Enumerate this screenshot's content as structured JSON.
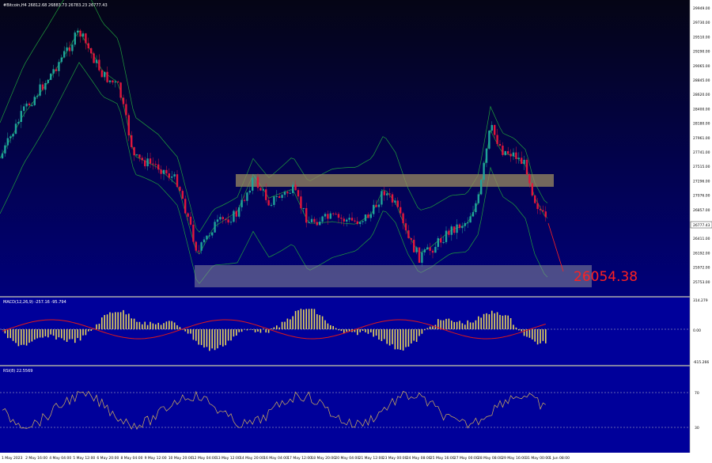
{
  "colors": {
    "bg_top": "#0a0a2a",
    "bg_bottom": "#000088",
    "bull": "#1fa39a",
    "bear": "#e0163c",
    "bands": "#1f9e3c",
    "zone": "#9a8a60",
    "zone_bottom": "#8a8a9a",
    "macd_hist": "#e8d65a",
    "macd_signal": "#e01818",
    "rsi_line": "#d4b25a",
    "axis_text": "#d0d0d0",
    "target_text": "#ff2020",
    "arrow": "#ff2020"
  },
  "header": {
    "symbol_info": "#Bitcoin,H4  26812.68 26883.73 26783.23 26777.43"
  },
  "price_axis": {
    "labels": [
      "29949.00",
      "29730.00",
      "29510.00",
      "29290.00",
      "29065.00",
      "28845.00",
      "28620.00",
      "28400.00",
      "28180.00",
      "27961.00",
      "27741.00",
      "27515.00",
      "27296.00",
      "27076.00",
      "26857.00",
      "26631.00",
      "26411.00",
      "26192.00",
      "25972.00",
      "25753.00"
    ],
    "current_price": "26777.43"
  },
  "target_label": "26054.38",
  "macd": {
    "label": "MACD(12,26,9) -257.16 -95.794",
    "axis": [
      "314.279",
      "0.00",
      "-615.266"
    ]
  },
  "rsi": {
    "label": "RSI(8) 22.5569",
    "axis": [
      "70",
      "30"
    ]
  },
  "time_axis": {
    "labels": [
      "1 May 2023",
      "2 May 16:00",
      "4 May 04:00",
      "5 May 12:00",
      "6 May 20:00",
      "8 May 04:00",
      "9 May 12:00",
      "10 May 20:00",
      "12 May 04:00",
      "13 May 12:00",
      "14 May 20:00",
      "16 May 04:00",
      "17 May 12:00",
      "18 May 20:00",
      "20 May 04:00",
      "21 May 12:00",
      "23 May 00:00",
      "24 May 08:00",
      "25 May 16:00",
      "27 May 00:00",
      "28 May 08:00",
      "29 May 16:00",
      "31 May 00:00",
      "1 Jun 08:00"
    ]
  }
}
